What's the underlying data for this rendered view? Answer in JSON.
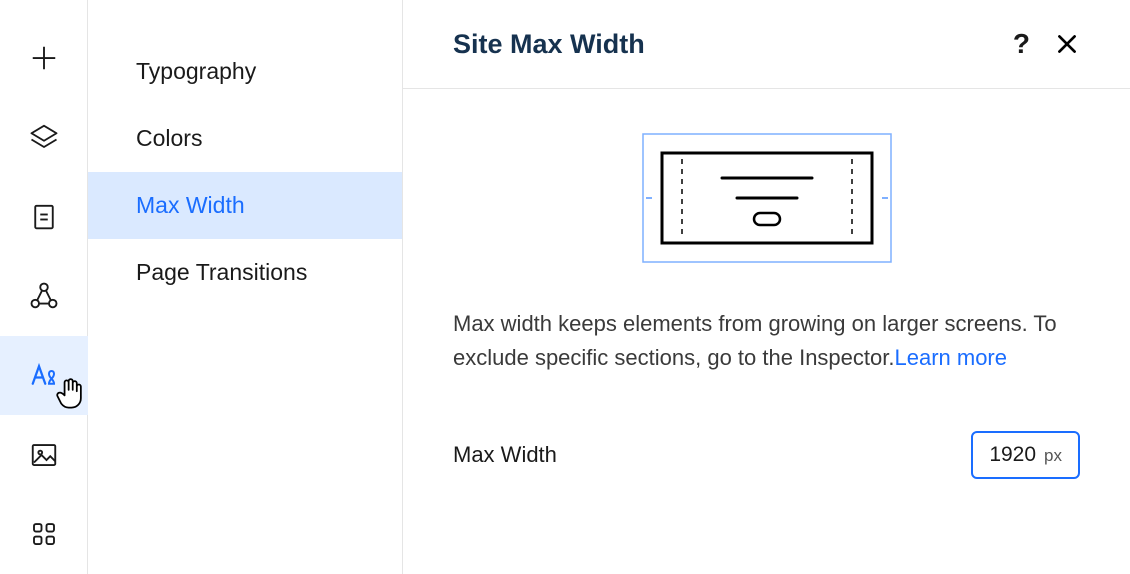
{
  "rail": {
    "items": [
      {
        "name": "add-icon",
        "active": false
      },
      {
        "name": "layers-icon",
        "active": false
      },
      {
        "name": "page-icon",
        "active": false
      },
      {
        "name": "connections-icon",
        "active": false
      },
      {
        "name": "typography-icon",
        "active": true
      },
      {
        "name": "image-icon",
        "active": false
      },
      {
        "name": "apps-icon",
        "active": false
      }
    ]
  },
  "subnav": {
    "items": [
      {
        "label": "Typography",
        "active": false
      },
      {
        "label": "Colors",
        "active": false
      },
      {
        "label": "Max Width",
        "active": true
      },
      {
        "label": "Page Transitions",
        "active": false
      }
    ]
  },
  "panel": {
    "title": "Site Max Width",
    "help_glyph": "?",
    "description": "Max width keeps elements from growing on larger screens. To exclude specific sections, go to the Inspector.",
    "learn_more": "Learn more",
    "control_label": "Max Width",
    "width_value": "1920",
    "width_unit": "px"
  }
}
